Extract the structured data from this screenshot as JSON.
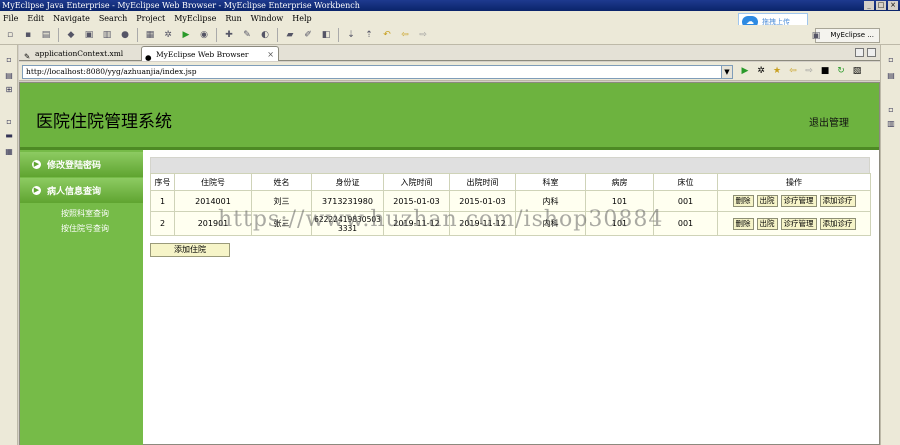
{
  "window": {
    "title": "MyEclipse Java Enterprise - MyEclipse Web Browser - MyEclipse Enterprise Workbench"
  },
  "menu": [
    "File",
    "Edit",
    "Navigate",
    "Search",
    "Project",
    "MyEclipse",
    "Run",
    "Window",
    "Help"
  ],
  "upload_widget": {
    "label": "拖拽上传"
  },
  "perspective": {
    "label": "MyEclipse ..."
  },
  "tabs": [
    {
      "label": "applicationContext.xml"
    },
    {
      "label": "MyEclipse Web Browser"
    }
  ],
  "address": {
    "url": "http://localhost:8080/yyg/azhuanjia/index.jsp"
  },
  "page": {
    "title": "医院住院管理系统",
    "logout": "退出管理",
    "sidebar": {
      "section1": "修改登陆密码",
      "section2": "病人信息查询",
      "links": [
        "按照科室查询",
        "按住院号查询"
      ]
    },
    "table": {
      "columns": [
        "序号",
        "住院号",
        "姓名",
        "身份证",
        "入院时间",
        "出院时间",
        "科室",
        "病房",
        "床位",
        "操作"
      ],
      "rows": [
        {
          "no": "1",
          "admission_no": "2014001",
          "name": "刘三",
          "id_card": "3713231980",
          "admit_date": "2015-01-03",
          "discharge_date": "2015-01-03",
          "department": "内科",
          "ward": "101",
          "bed": "001"
        },
        {
          "no": "2",
          "admission_no": "201901",
          "name": "张三",
          "id_card": "622224198305033331",
          "admit_date": "2019-11-12",
          "discharge_date": "2019-11-12",
          "department": "内科",
          "ward": "101",
          "bed": "001"
        }
      ],
      "actions": [
        "删除",
        "出院",
        "诊疗管理",
        "添加诊疗"
      ]
    },
    "add_button": "添加住院"
  },
  "watermark": "https://www.huzhan.com/ishop30884"
}
